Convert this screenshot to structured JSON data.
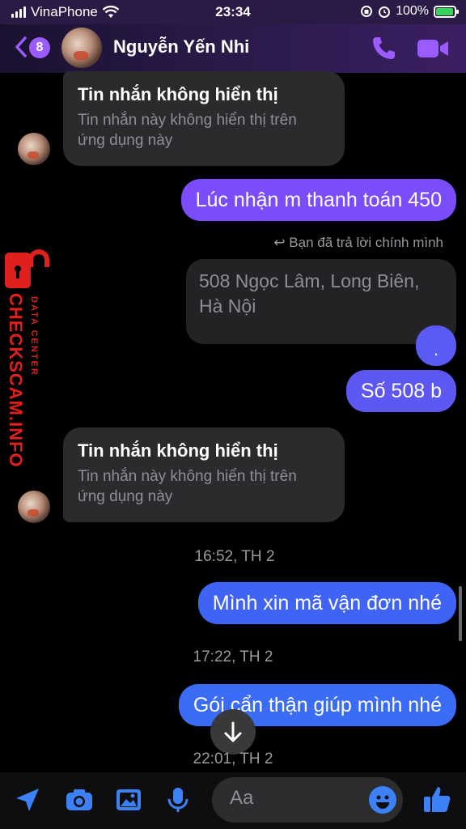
{
  "status_bar": {
    "carrier": "VinaPhone",
    "time": "23:34",
    "battery": "100%"
  },
  "header": {
    "unread_count": "8",
    "contact_name": "Nguyễn Yến Nhi",
    "accent_color": "#9b5cff"
  },
  "messages": {
    "hidden1": {
      "title": "Tin nhắn không hiển thị",
      "line1": "Tin nhắn này không hiển thị trên",
      "line2": "ứng dụng này"
    },
    "out1": "Lúc nhận m thanh toán 450",
    "reply_note": "Bạn đã trả lời chính mình",
    "quoted_line1": "508 Ngọc Lâm, Long Biên,",
    "quoted_line2": "Hà Nội",
    "dot": ".",
    "out2": "Số 508 b",
    "hidden2": {
      "title": "Tin nhắn không hiển thị",
      "line1": "Tin nhắn này không hiển thị trên",
      "line2": "ứng dụng này"
    },
    "ts1": "16:52, TH 2",
    "out3": "Mình xin mã vận đơn nhé",
    "ts2": "17:22, TH 2",
    "out4": "Gói cẩn thận giúp mình nhé",
    "ts3": "22:01, TH 2"
  },
  "watermark": {
    "main": "CHECKSCAM.INFO",
    "sub": "DATA CENTER"
  },
  "composer": {
    "placeholder": "Aa"
  },
  "colors": {
    "out_purple": "#7b4dfa",
    "out_blue": "#3a6cf5",
    "incoming_gray": "#2b2b2d",
    "watermark_red": "#e0201e"
  }
}
